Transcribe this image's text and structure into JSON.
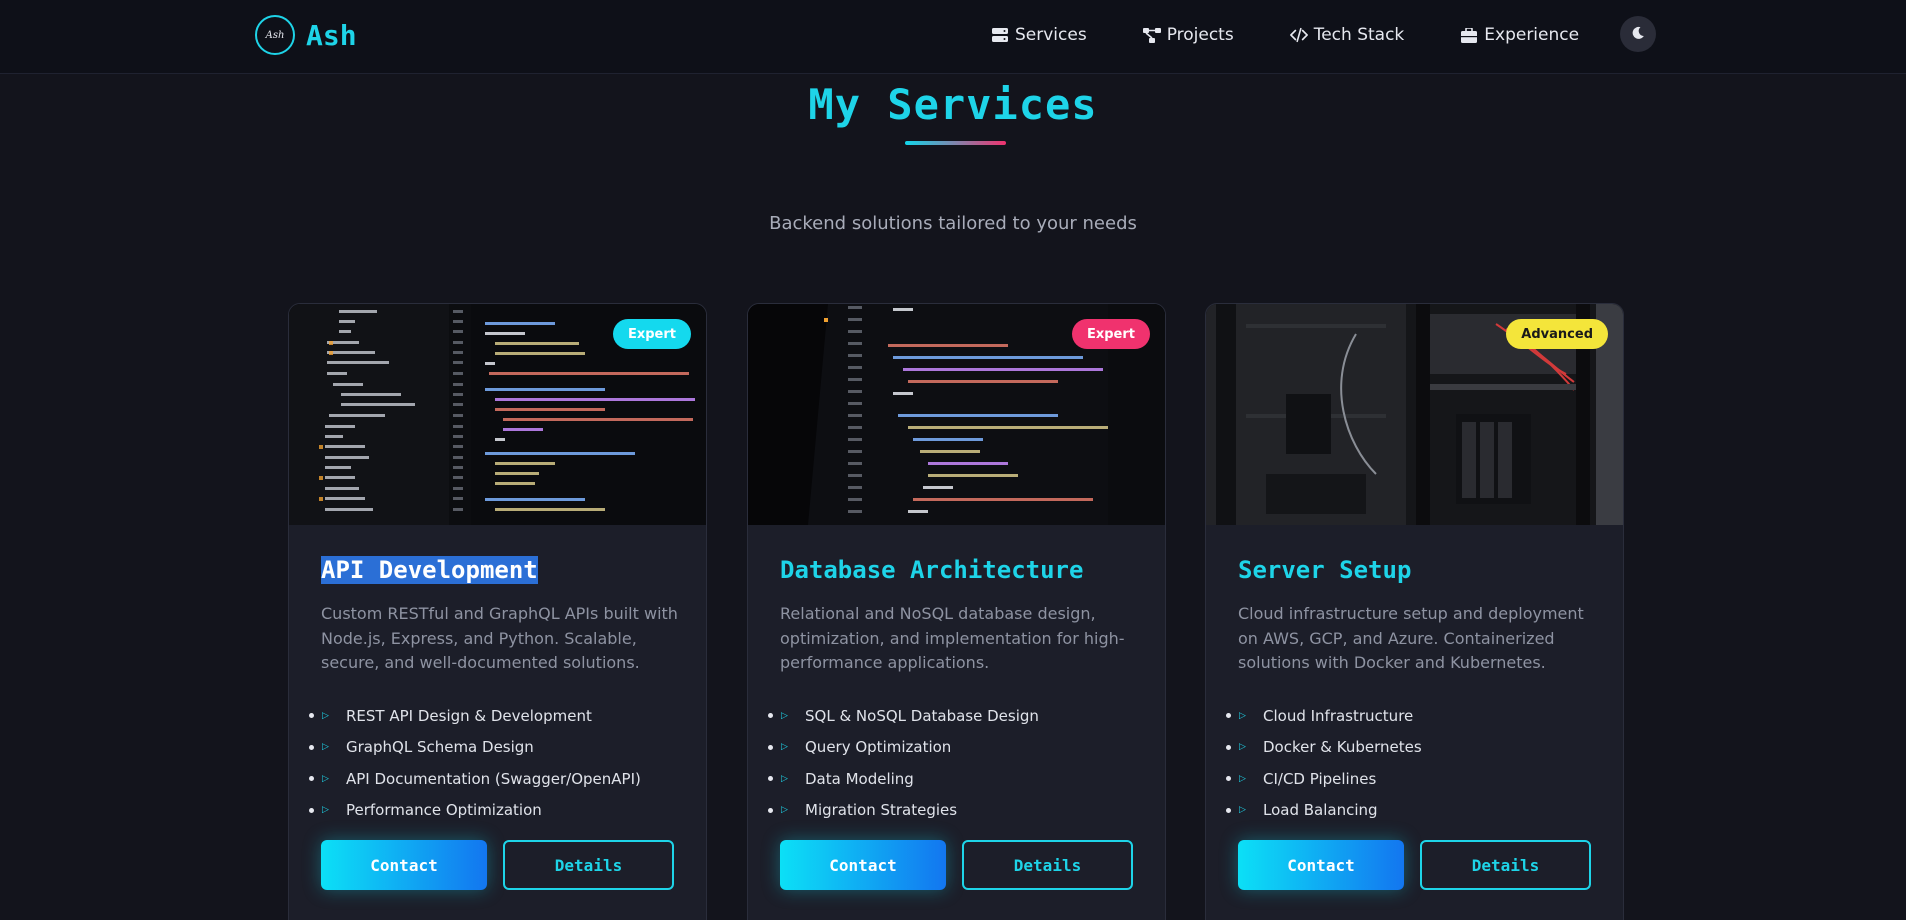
{
  "nav": {
    "logo_text": "Ash",
    "brand": "Ash",
    "links": [
      {
        "label": "Services",
        "icon": "server-icon"
      },
      {
        "label": "Projects",
        "icon": "project-diagram-icon"
      },
      {
        "label": "Tech Stack",
        "icon": "code-icon"
      },
      {
        "label": "Experience",
        "icon": "briefcase-icon"
      }
    ],
    "theme_icon": "moon-icon"
  },
  "section": {
    "title": "My Services",
    "subtitle": "Backend solutions tailored to your needs"
  },
  "colors": {
    "accent": "#1ed4e8",
    "pink": "#f0326e",
    "yellow": "#f4e53a",
    "background": "#13141c",
    "card": "#1c1e29"
  },
  "services": [
    {
      "badge": "Expert",
      "badge_color": "cyan",
      "title": "API Development",
      "title_selected": true,
      "description": "Custom RESTful and GraphQL APIs built with Node.js, Express, and Python. Scalable, secure, and well-documented solutions.",
      "features": [
        "REST API Design & Development",
        "GraphQL Schema Design",
        "API Documentation (Swagger/OpenAPI)",
        "Performance Optimization"
      ],
      "contact_label": "Contact",
      "details_label": "Details"
    },
    {
      "badge": "Expert",
      "badge_color": "pink",
      "title": "Database Architecture",
      "title_selected": false,
      "description": "Relational and NoSQL database design, optimization, and implementation for high-performance applications.",
      "features": [
        "SQL & NoSQL Database Design",
        "Query Optimization",
        "Data Modeling",
        "Migration Strategies"
      ],
      "contact_label": "Contact",
      "details_label": "Details"
    },
    {
      "badge": "Advanced",
      "badge_color": "yellow",
      "title": "Server Setup",
      "title_selected": false,
      "description": "Cloud infrastructure setup and deployment on AWS, GCP, and Azure. Containerized solutions with Docker and Kubernetes.",
      "features": [
        "Cloud Infrastructure",
        "Docker & Kubernetes",
        "CI/CD Pipelines",
        "Load Balancing"
      ],
      "contact_label": "Contact",
      "details_label": "Details"
    }
  ]
}
